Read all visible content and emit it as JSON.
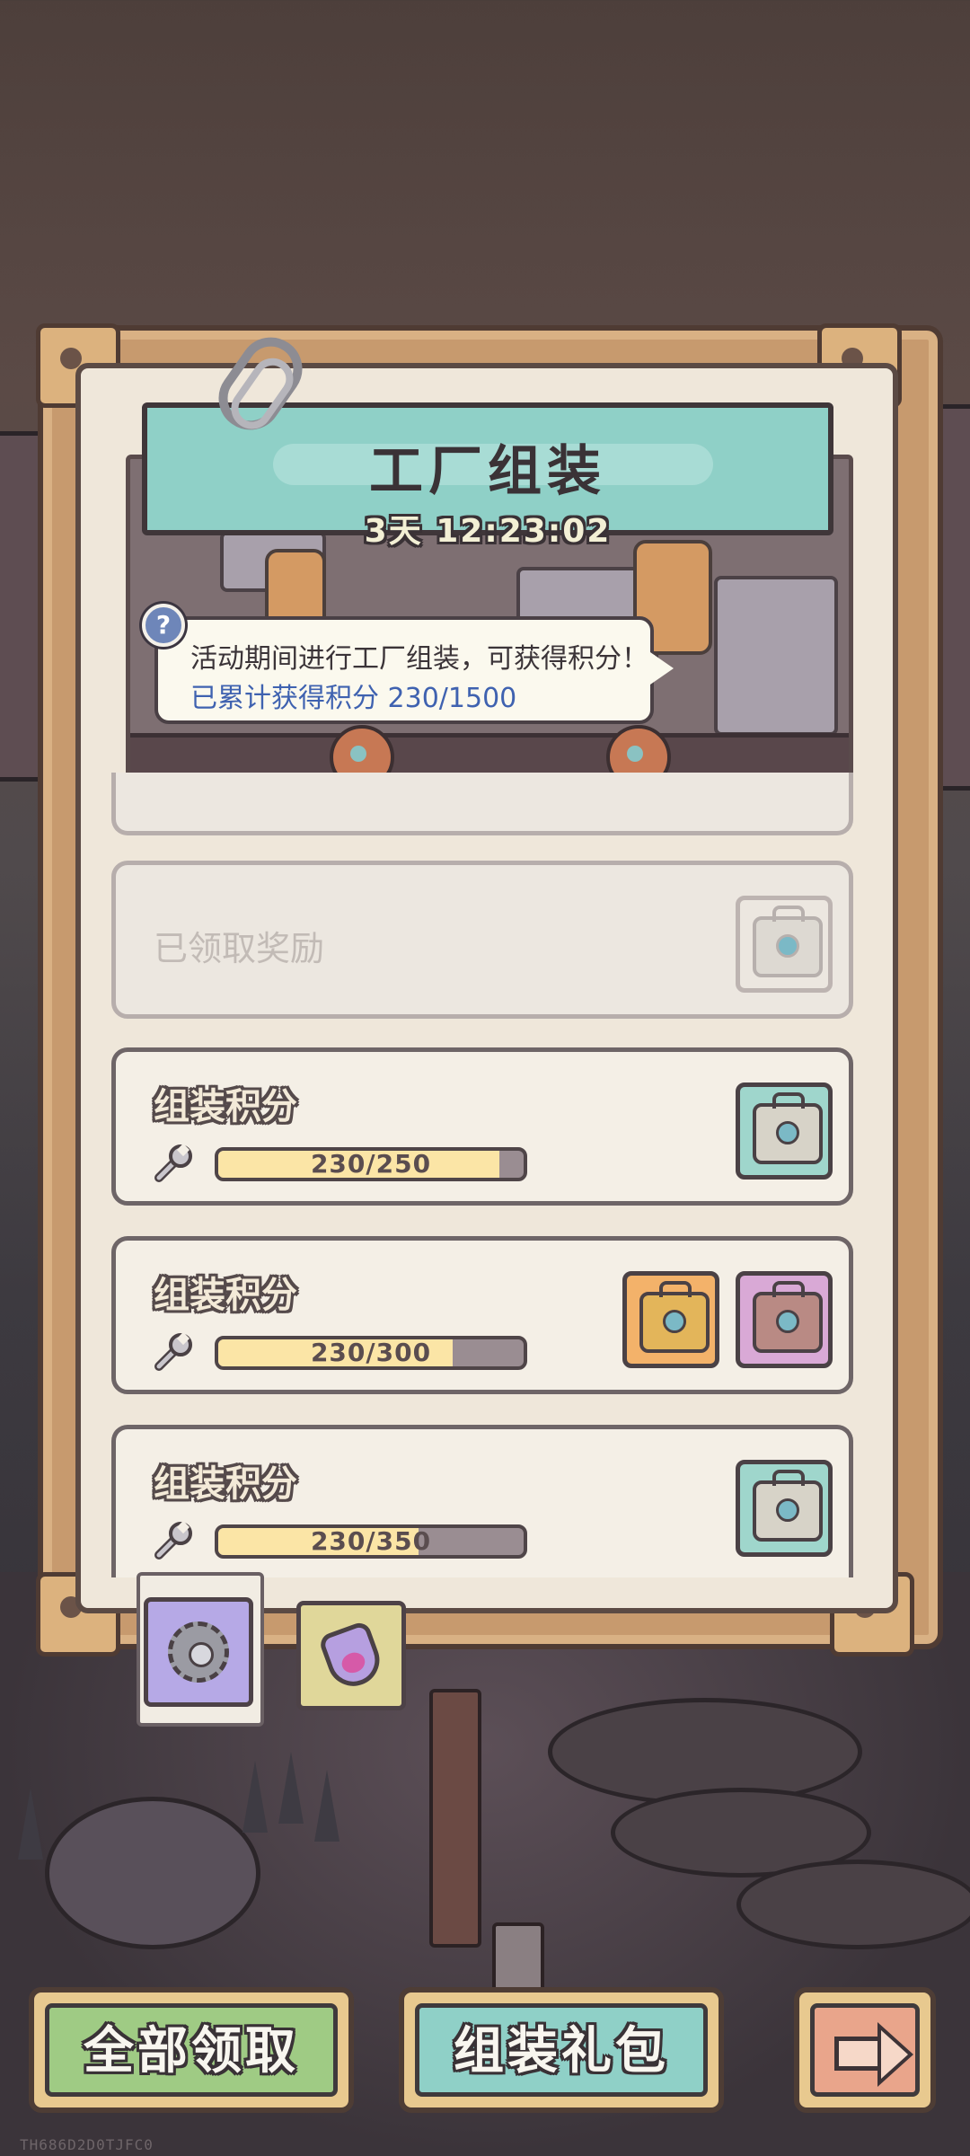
{
  "event": {
    "title": "工厂组装",
    "timer": "3天 12:23:02",
    "tip_line1": "活动期间进行工厂组装，可获得积分！",
    "tip_line2": "已累计获得积分  230/1500",
    "help_symbol": "?"
  },
  "rewards": [
    {
      "label": "已领取奖励",
      "state": "claimed",
      "chests": [
        "gray"
      ]
    },
    {
      "label": "组装积分",
      "progress_text": "230/250",
      "progress": 0.92,
      "chests": [
        "blue"
      ]
    },
    {
      "label": "组装积分",
      "progress_text": "230/300",
      "progress": 0.767,
      "chests": [
        "gold",
        "pink"
      ]
    },
    {
      "label": "组装积分",
      "progress_text": "230/350",
      "progress": 0.657,
      "chests": [
        "blue"
      ]
    }
  ],
  "tabs": [
    {
      "name": "assembly",
      "icon": "gear-icon",
      "selected": true
    },
    {
      "name": "potion",
      "icon": "potion-icon",
      "selected": false
    }
  ],
  "buttons": {
    "claim_all": "全部领取",
    "assembly_pack": "组装礼包",
    "next": "arrow-right-icon"
  },
  "colors": {
    "claim_all_button": "#9fcb84",
    "assembly_pack_button": "#8fd0c7",
    "next_button": "#e9a58b",
    "title_banner": "#8fd0c7",
    "tip_highlight": "#3f62b0",
    "progress_fill": "#fbe5a6"
  },
  "watermark": "TH686D2D0TJFC0"
}
